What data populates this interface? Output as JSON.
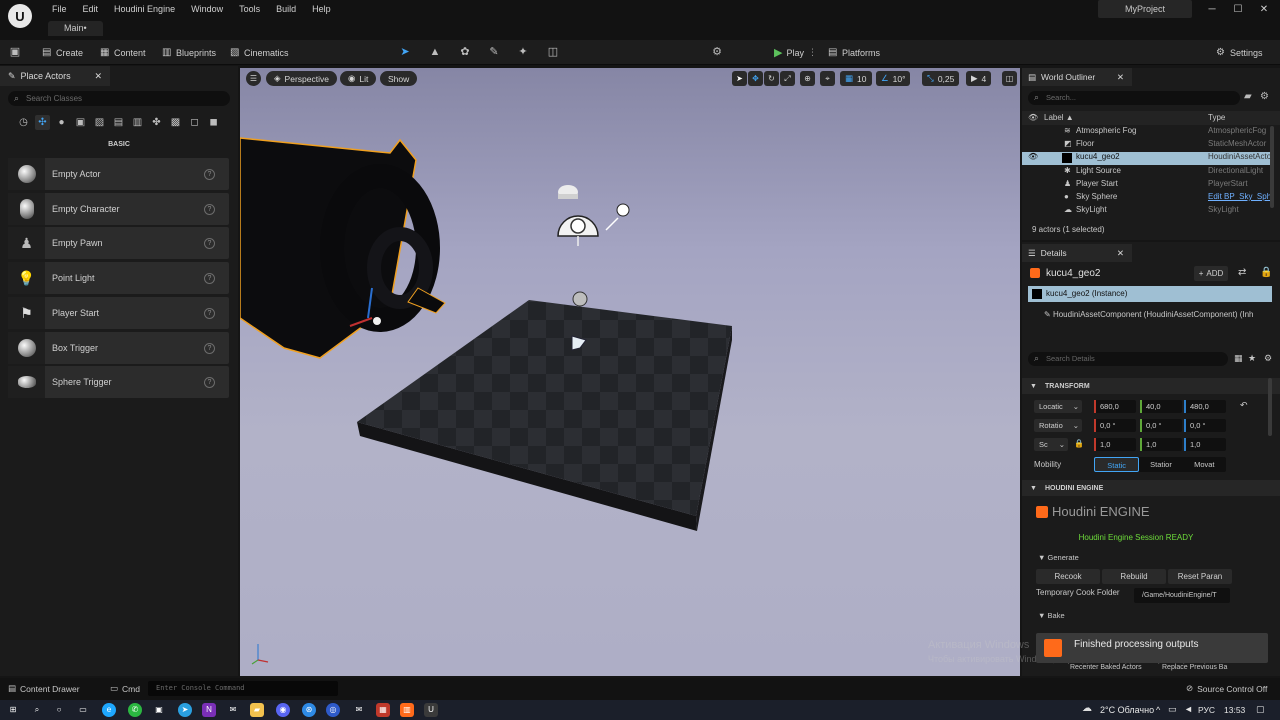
{
  "window": {
    "menu": [
      "File",
      "Edit",
      "Houdini Engine",
      "Window",
      "Tools",
      "Build",
      "Help"
    ],
    "level_tab": "Main•",
    "project": "MyProject",
    "minimize": "─",
    "maximize": "☐",
    "close": "✕"
  },
  "toolbar": {
    "create": "Create",
    "content": "Content",
    "blueprints": "Blueprints",
    "cinematics": "Cinematics",
    "play": "Play",
    "platforms": "Platforms",
    "settings": "Settings"
  },
  "place_actors": {
    "tab": "Place Actors",
    "search_placeholder": "Search Classes",
    "section": "BASIC",
    "items": [
      "Empty Actor",
      "Empty Character",
      "Empty Pawn",
      "Point Light",
      "Player Start",
      "Box Trigger",
      "Sphere Trigger"
    ]
  },
  "viewport": {
    "perspective": "Perspective",
    "lit": "Lit",
    "show": "Show",
    "grid_snap": "10",
    "rotation_snap": "10°",
    "scale_snap": "0,25",
    "camera_speed": "4"
  },
  "outliner": {
    "tab": "World Outliner",
    "search_placeholder": "Search...",
    "col_label": "Label ▲",
    "col_type": "Type",
    "rows": [
      {
        "label": "Atmospheric Fog",
        "type": "AtmosphericFog"
      },
      {
        "label": "Floor",
        "type": "StaticMeshActor"
      },
      {
        "label": "kucu4_geo2",
        "type": "HoudiniAssetActor"
      },
      {
        "label": "Light Source",
        "type": "DirectionalLight"
      },
      {
        "label": "Player Start",
        "type": "PlayerStart"
      },
      {
        "label": "Sky Sphere",
        "type": "Edit BP_Sky_Sphere"
      },
      {
        "label": "SkyLight",
        "type": "SkyLight"
      }
    ],
    "count": "9 actors (1 selected)"
  },
  "details": {
    "tab": "Details",
    "actor_name": "kucu4_geo2",
    "add": "ADD",
    "instance": "kucu4_geo2  (Instance)",
    "component": "HoudiniAssetComponent (HoudiniAssetComponent) (Inh",
    "search_placeholder": "Search Details",
    "transform_section": "TRANSFORM",
    "location_label": "Locatic",
    "rotation_label": "Rotatio",
    "scale_label": "Sc",
    "location": [
      "680,0",
      "40,0",
      "480,0"
    ],
    "rotation": [
      "0,0 °",
      "0,0 °",
      "0,0 °"
    ],
    "scale": [
      "1,0",
      "1,0",
      "1,0"
    ],
    "mobility_label": "Mobility",
    "mobility": [
      "Static",
      "Statior",
      "Movat"
    ],
    "houdini_section": "HOUDINI ENGINE",
    "houdini_logo": "Houdini ENGINE",
    "session_status": "Houdini Engine Session READY",
    "generate": "Generate",
    "recook": "Recook",
    "rebuild": "Rebuild",
    "reset": "Reset Paran",
    "temp_folder_label": "Temporary Cook Folder",
    "temp_folder_value": "/Game/HoudiniEngine/T",
    "bake": "Bake",
    "recenter": "Recenter Baked Actors",
    "replace": "Replace Previous Ba"
  },
  "notification": {
    "text": "Finished processing outputs",
    "watermark_title": "Активация Windows",
    "watermark_sub": "Чтобы активировать Windows, перейдите в раздел \"Параметры\"."
  },
  "bottom": {
    "content_drawer": "Content Drawer",
    "cmd": "Cmd",
    "console_placeholder": "Enter Console Command",
    "source_control": "Source Control Off"
  },
  "taskbar": {
    "weather": "2°C  Облачно",
    "lang": "РУС",
    "time": "13:53"
  },
  "colors": {
    "accent_blue": "#42a5f5",
    "selection": "#9fbfd3",
    "play_green": "#5cc15c",
    "houdini_orange": "#ff6a1a",
    "status_green": "#6ddc3a"
  }
}
